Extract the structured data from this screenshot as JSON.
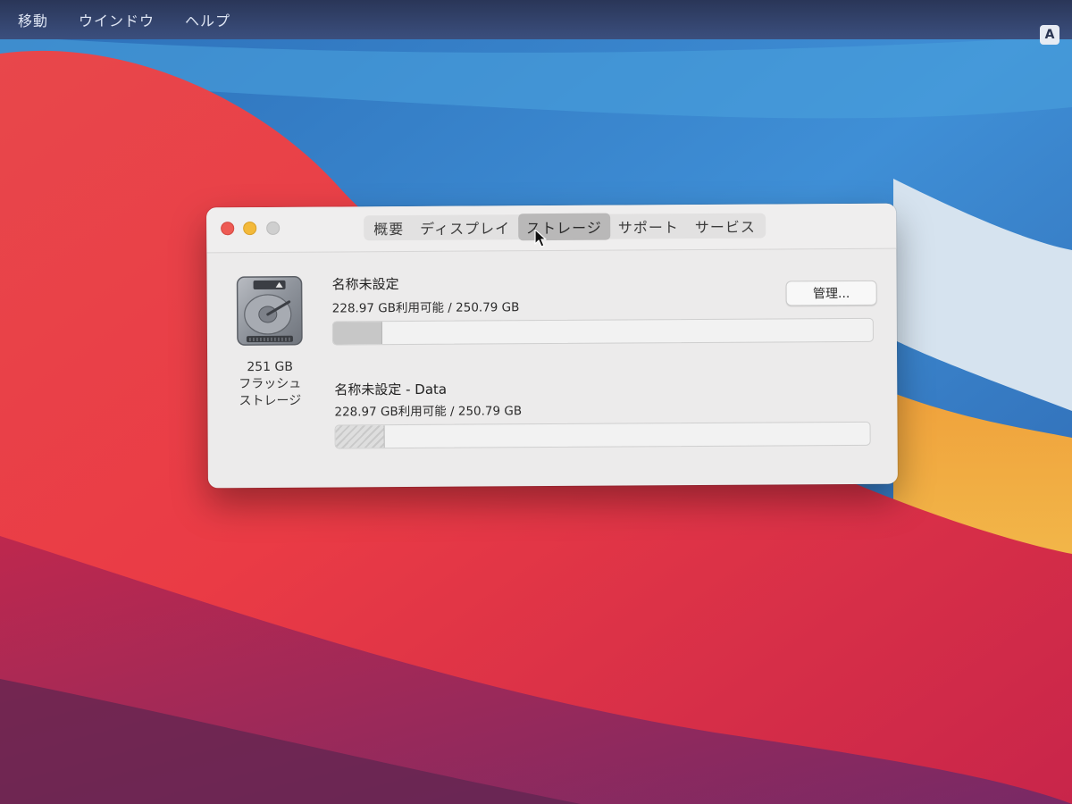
{
  "menubar": {
    "items": [
      "移動",
      "ウインドウ",
      "ヘルプ"
    ],
    "input_badge": "A"
  },
  "window": {
    "tabs": [
      {
        "label": "概要",
        "active": false
      },
      {
        "label": "ディスプレイ",
        "active": false
      },
      {
        "label": "ストレージ",
        "active": true
      },
      {
        "label": "サポート",
        "active": false
      },
      {
        "label": "サービス",
        "active": false
      }
    ],
    "disk": {
      "icon": "hard-drive-icon",
      "capacity": "251 GB",
      "type_line1": "フラッシュ",
      "type_line2": "ストレージ"
    },
    "volumes": [
      {
        "name": "名称未設定",
        "size_text": "228.97 GB利用可能 / 250.79 GB",
        "used_fraction": 0.09,
        "fill_style": "solid"
      },
      {
        "name": "名称未設定 - Data",
        "size_text": "228.97 GB利用可能 / 250.79 GB",
        "used_fraction": 0.09,
        "fill_style": "hatched"
      }
    ],
    "manage_button": "管理..."
  },
  "colors": {
    "close": "#ee5b54",
    "minimize": "#f3b93a",
    "zoom": "#cfcfcf",
    "window_bg": "#ecebeb"
  }
}
